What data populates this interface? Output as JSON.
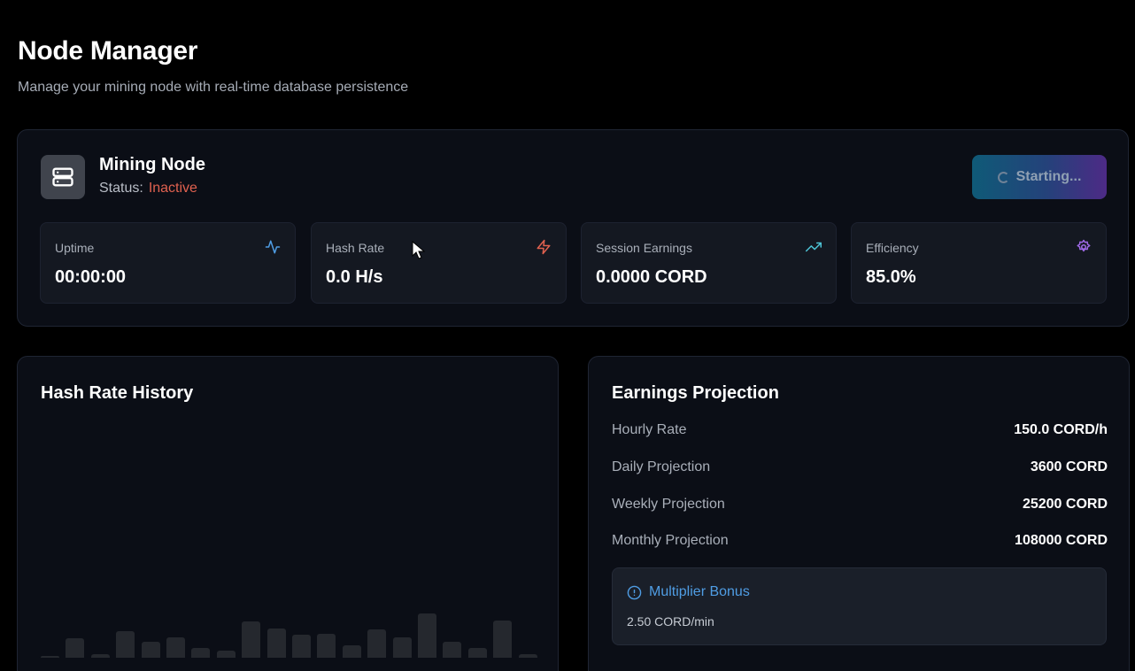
{
  "header": {
    "title": "Node Manager",
    "subtitle": "Manage your mining node with real-time database persistence"
  },
  "node": {
    "name": "Mining Node",
    "status_label": "Status:",
    "status_value": "Inactive",
    "status_color": "#e0614f",
    "icon": "server-icon",
    "action_label": "Starting...",
    "action_icon": "spinner-icon"
  },
  "stats": [
    {
      "label": "Uptime",
      "value": "00:00:00",
      "icon": "activity-icon",
      "icon_color": "#4f9de4"
    },
    {
      "label": "Hash Rate",
      "value": "0.0 H/s",
      "icon": "zap-icon",
      "icon_color": "#e0614f"
    },
    {
      "label": "Session Earnings",
      "value": "0.0000 CORD",
      "icon": "trending-up-icon",
      "icon_color": "#4ec4d6"
    },
    {
      "label": "Efficiency",
      "value": "85.0%",
      "icon": "settings-icon",
      "icon_color": "#a06ae8"
    }
  ],
  "hash_history": {
    "title": "Hash Rate History",
    "bar_color": "#25282e",
    "bar_levels": [
      0.03,
      0.31,
      0.06,
      0.43,
      0.25,
      0.33,
      0.16,
      0.12,
      0.59,
      0.47,
      0.37,
      0.39,
      0.2,
      0.45,
      0.33,
      0.71,
      0.25,
      0.16,
      0.6,
      0.06
    ]
  },
  "earnings": {
    "title": "Earnings Projection",
    "rows": [
      {
        "label": "Hourly Rate",
        "value": "150.0 CORD/h"
      },
      {
        "label": "Daily Projection",
        "value": "3600 CORD"
      },
      {
        "label": "Weekly Projection",
        "value": "25200 CORD"
      },
      {
        "label": "Monthly Projection",
        "value": "108000 CORD"
      }
    ],
    "bonus": {
      "title": "Multiplier Bonus",
      "icon": "info-icon",
      "rate": "2.50 CORD/min",
      "color": "#4f9de4"
    }
  },
  "accent_gradient": [
    "#0f5a77",
    "#4d2a86"
  ]
}
